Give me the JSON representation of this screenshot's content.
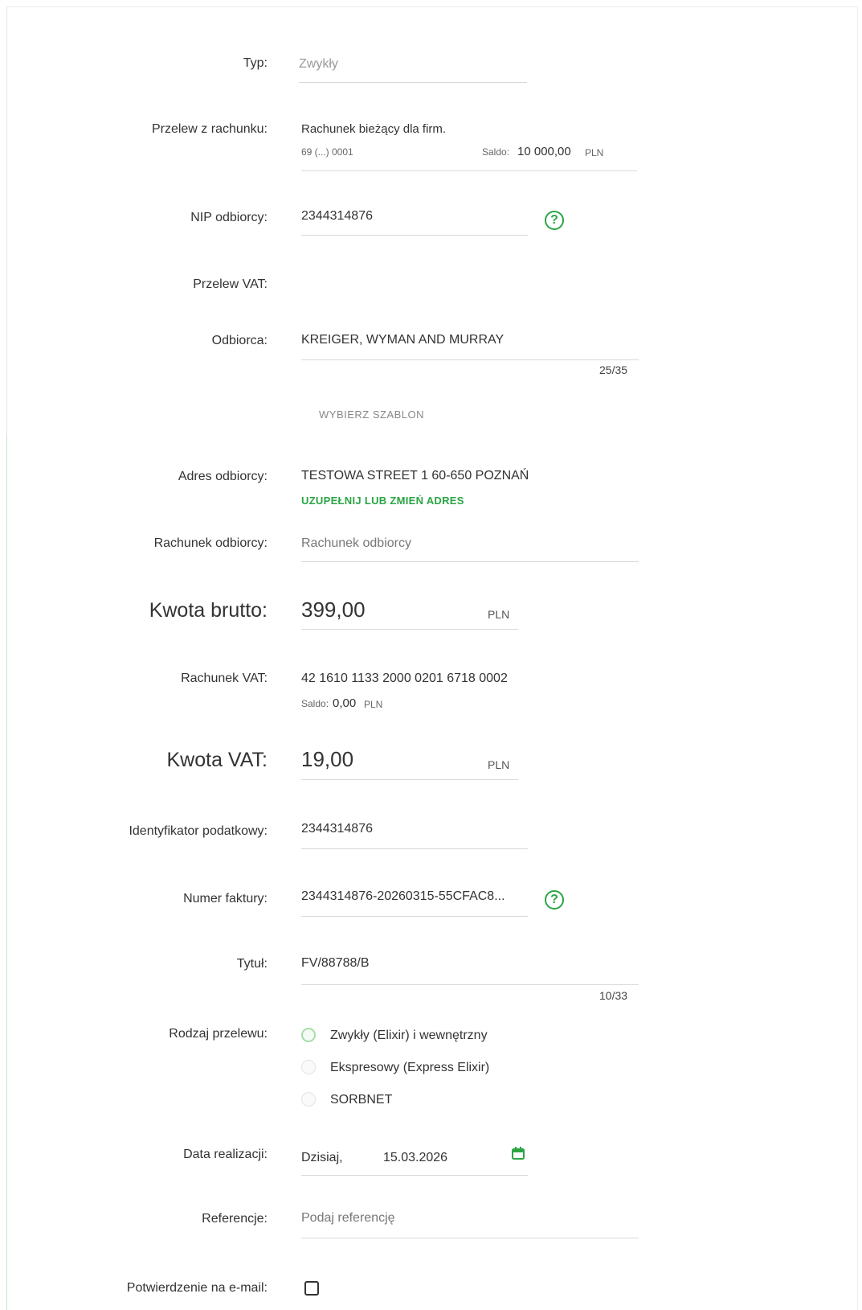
{
  "form": {
    "typ": {
      "label": "Typ:",
      "value": "Zwykły"
    },
    "przelew_z_rachunku": {
      "label": "Przelew z rachunku:",
      "account_name": "Rachunek bieżący dla firm.",
      "account_number": "69 (...) 0001",
      "saldo_label": "Saldo:",
      "saldo_value": "10 000,00",
      "saldo_currency": "PLN"
    },
    "nip_odbiorcy": {
      "label": "NIP odbiorcy:",
      "value": "2344314876",
      "help": "?"
    },
    "przelew_vat": {
      "label": "Przelew VAT:"
    },
    "odbiorca": {
      "label": "Odbiorca:",
      "value": "KREIGER, WYMAN AND MURRAY",
      "counter": "25/35",
      "template_button": "WYBIERZ SZABLON"
    },
    "adres_odbiorcy": {
      "label": "Adres odbiorcy:",
      "value": "TESTOWA STREET 1 60-650 POZNAŃ",
      "link": "UZUPEŁNIJ LUB ZMIEŃ ADRES"
    },
    "rachunek_odbiorcy": {
      "label": "Rachunek odbiorcy:",
      "placeholder": "Rachunek odbiorcy"
    },
    "kwota_brutto": {
      "label": "Kwota brutto:",
      "value": "399,00",
      "currency": "PLN"
    },
    "rachunek_vat": {
      "label": "Rachunek VAT:",
      "value": "42 1610 1133 2000 0201 6718 0002",
      "saldo_label": "Saldo:",
      "saldo_value": "0,00",
      "saldo_currency": "PLN"
    },
    "kwota_vat": {
      "label": "Kwota VAT:",
      "value": "19,00",
      "currency": "PLN"
    },
    "identyfikator": {
      "label": "Identyfikator podatkowy:",
      "value": "2344314876"
    },
    "numer_faktury": {
      "label": "Numer faktury:",
      "value": "2344314876-20260315-55CFAC8...",
      "help": "?"
    },
    "tytul": {
      "label": "Tytuł:",
      "value": "FV/88788/B",
      "counter": "10/33"
    },
    "rodzaj_przelewu": {
      "label": "Rodzaj przelewu:",
      "options": [
        "Zwykły (Elixir) i wewnętrzny",
        "Ekspresowy (Express Elixir)",
        "SORBNET"
      ],
      "selected": 0
    },
    "data_realizacji": {
      "label": "Data realizacji:",
      "day_label": "Dzisiaj,",
      "date": "15.03.2026"
    },
    "referencje": {
      "label": "Referencje:",
      "placeholder": "Podaj referencję"
    },
    "potwierdzenie": {
      "label": "Potwierdzenie na e-mail:"
    }
  },
  "colors": {
    "accent": "#2aa544",
    "line": "#d8d8d8",
    "muted": "#9a9a9a"
  },
  "icons": {
    "help": "help-circle-icon",
    "calendar": "calendar-icon"
  }
}
